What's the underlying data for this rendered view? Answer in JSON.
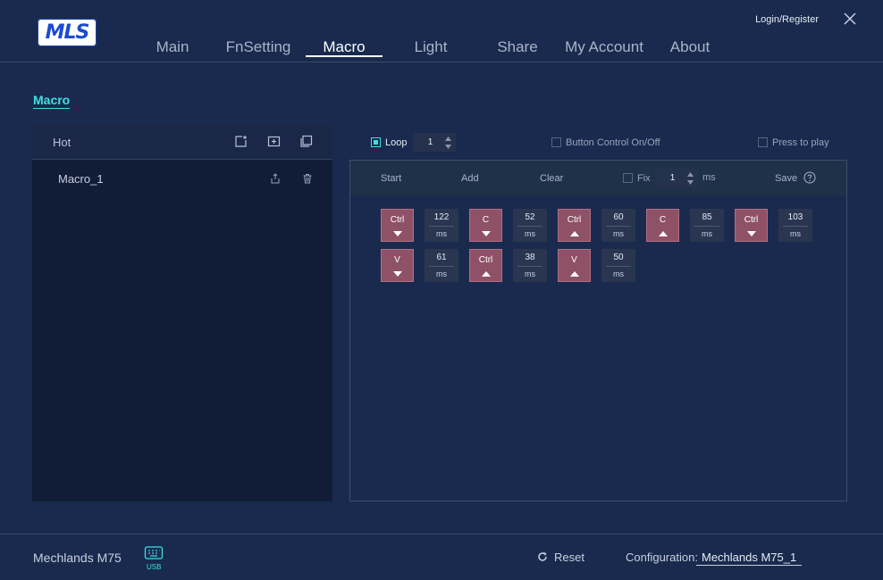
{
  "app": {
    "logo_text": "MLS",
    "login_label": "Login/Register"
  },
  "nav": {
    "tabs": [
      "Main",
      "FnSetting",
      "Macro",
      "Light",
      "Share",
      "My Account",
      "About"
    ],
    "active": "Macro"
  },
  "section_title": "Macro",
  "macro_list": {
    "header": "Hot",
    "items": [
      "Macro_1"
    ]
  },
  "controls": {
    "loop_label": "Loop",
    "loop_count": "1",
    "button_control_label": "Button Control On/Off",
    "press_to_play_label": "Press to play"
  },
  "editor_bar": {
    "start": "Start",
    "add": "Add",
    "clear": "Clear",
    "fix_label": "Fix",
    "fix_value": "1",
    "fix_unit": "ms",
    "save": "Save"
  },
  "sequence": [
    {
      "type": "key",
      "key": "Ctrl",
      "action": "down"
    },
    {
      "type": "delay",
      "value": "122",
      "unit": "ms"
    },
    {
      "type": "key",
      "key": "C",
      "action": "down"
    },
    {
      "type": "delay",
      "value": "52",
      "unit": "ms"
    },
    {
      "type": "key",
      "key": "Ctrl",
      "action": "up"
    },
    {
      "type": "delay",
      "value": "60",
      "unit": "ms"
    },
    {
      "type": "key",
      "key": "C",
      "action": "up"
    },
    {
      "type": "delay",
      "value": "85",
      "unit": "ms"
    },
    {
      "type": "key",
      "key": "Ctrl",
      "action": "down"
    },
    {
      "type": "delay",
      "value": "103",
      "unit": "ms"
    },
    {
      "type": "key",
      "key": "V",
      "action": "down"
    },
    {
      "type": "delay",
      "value": "61",
      "unit": "ms"
    },
    {
      "type": "key",
      "key": "Ctrl",
      "action": "up"
    },
    {
      "type": "delay",
      "value": "38",
      "unit": "ms"
    },
    {
      "type": "key",
      "key": "V",
      "action": "up"
    },
    {
      "type": "delay",
      "value": "50",
      "unit": "ms"
    }
  ],
  "footer": {
    "device_name": "Mechlands M75",
    "connection": "USB",
    "reset_label": "Reset",
    "config_label": "Configuration:",
    "config_value": "Mechlands M75_1"
  },
  "colors": {
    "background": "#192a4e",
    "accent": "#3de0e0",
    "key_fill": "#8f5166"
  }
}
